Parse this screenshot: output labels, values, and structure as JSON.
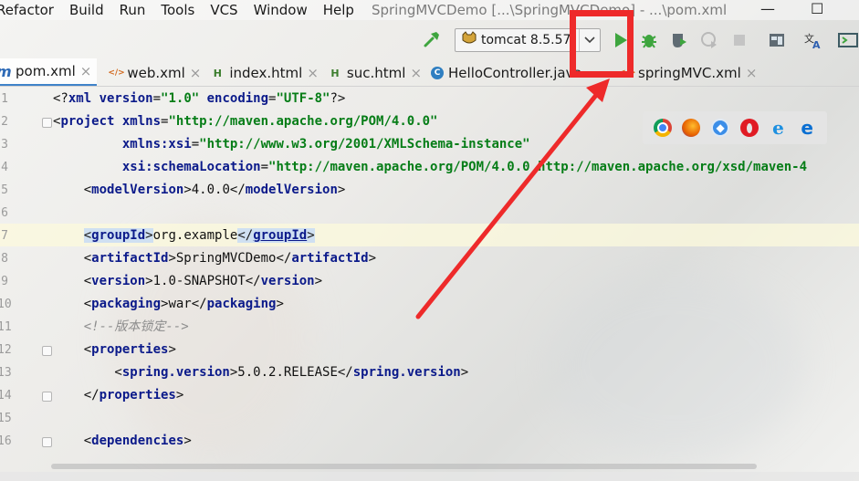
{
  "menu": {
    "items": [
      "Refactor",
      "Build",
      "Run",
      "Tools",
      "VCS",
      "Window",
      "Help"
    ],
    "title": "SpringMVCDemo [...\\SpringMVCDemo] - ...\\pom.xml",
    "minimize": "—",
    "maximize": "☐"
  },
  "toolbar": {
    "run_config": "tomcat 8.5.57"
  },
  "tabs": [
    {
      "label": "pom.xml",
      "icon": "m",
      "active": true
    },
    {
      "label": "web.xml",
      "icon": "</>",
      "active": false
    },
    {
      "label": "index.html",
      "icon": "H",
      "active": false
    },
    {
      "label": "suc.html",
      "icon": "H",
      "active": false
    },
    {
      "label": "HelloController.java",
      "icon": "C",
      "active": false
    },
    {
      "label": "springMVC.xml",
      "icon": "</>",
      "active": false
    }
  ],
  "editor": {
    "line_numbers": [
      "1",
      "2",
      "3",
      "4",
      "5",
      "6",
      "7",
      "8",
      "9",
      "10",
      "11",
      "12",
      "13",
      "14",
      "15",
      "16"
    ],
    "lines": [
      {
        "parts": [
          [
            "txt",
            "<?"
          ],
          [
            "tag",
            "xml "
          ],
          [
            "attr",
            "version"
          ],
          [
            "txt",
            "="
          ],
          [
            "val",
            "\"1.0\" "
          ],
          [
            "attr",
            "encoding"
          ],
          [
            "txt",
            "="
          ],
          [
            "val",
            "\"UTF-8\""
          ],
          [
            "txt",
            "?>"
          ]
        ]
      },
      {
        "parts": [
          [
            "txt",
            "<"
          ],
          [
            "tag",
            "project "
          ],
          [
            "attr",
            "xmlns"
          ],
          [
            "txt",
            "="
          ],
          [
            "val",
            "\"http://maven.apache.org/POM/4.0.0\""
          ]
        ]
      },
      {
        "parts": [
          [
            "txt",
            "         "
          ],
          [
            "attr",
            "xmlns:xsi"
          ],
          [
            "txt",
            "="
          ],
          [
            "val",
            "\"http://www.w3.org/2001/XMLSchema-instance\""
          ]
        ]
      },
      {
        "parts": [
          [
            "txt",
            "         "
          ],
          [
            "attr",
            "xsi:schemaLocation"
          ],
          [
            "txt",
            "="
          ],
          [
            "val",
            "\"http://maven.apache.org/POM/4.0.0 http://maven.apache.org/xsd/maven-4"
          ]
        ]
      },
      {
        "parts": [
          [
            "txt",
            "    <"
          ],
          [
            "tag",
            "modelVersion"
          ],
          [
            "txt",
            ">4.0.0</"
          ],
          [
            "tag",
            "modelVersion"
          ],
          [
            "txt",
            ">"
          ]
        ]
      },
      {
        "parts": []
      },
      {
        "parts": [
          [
            "txt",
            "    "
          ],
          [
            "hl",
            "<groupId>"
          ],
          [
            "txt",
            "org.example"
          ],
          [
            "hl",
            "</groupId>"
          ]
        ]
      },
      {
        "parts": [
          [
            "txt",
            "    <"
          ],
          [
            "tag",
            "artifactId"
          ],
          [
            "txt",
            ">SpringMVCDemo</"
          ],
          [
            "tag",
            "artifactId"
          ],
          [
            "txt",
            ">"
          ]
        ]
      },
      {
        "parts": [
          [
            "txt",
            "    <"
          ],
          [
            "tag",
            "version"
          ],
          [
            "txt",
            ">1.0-SNAPSHOT</"
          ],
          [
            "tag",
            "version"
          ],
          [
            "txt",
            ">"
          ]
        ]
      },
      {
        "parts": [
          [
            "txt",
            "    <"
          ],
          [
            "tag",
            "packaging"
          ],
          [
            "txt",
            ">war</"
          ],
          [
            "tag",
            "packaging"
          ],
          [
            "txt",
            ">"
          ]
        ]
      },
      {
        "parts": [
          [
            "txt",
            "    "
          ],
          [
            "cmt",
            "<!--版本锁定-->"
          ]
        ]
      },
      {
        "parts": [
          [
            "txt",
            "    <"
          ],
          [
            "tag",
            "properties"
          ],
          [
            "txt",
            ">"
          ]
        ]
      },
      {
        "parts": [
          [
            "txt",
            "        <"
          ],
          [
            "tag",
            "spring.version"
          ],
          [
            "txt",
            ">5.0.2.RELEASE</"
          ],
          [
            "tag",
            "spring.version"
          ],
          [
            "txt",
            ">"
          ]
        ]
      },
      {
        "parts": [
          [
            "txt",
            "    </"
          ],
          [
            "tag",
            "properties"
          ],
          [
            "txt",
            ">"
          ]
        ]
      },
      {
        "parts": []
      },
      {
        "parts": [
          [
            "txt",
            "    <"
          ],
          [
            "tag",
            "dependencies"
          ],
          [
            "txt",
            ">"
          ]
        ]
      }
    ]
  },
  "browsers": [
    "chrome-icon",
    "firefox-icon",
    "safari-icon",
    "opera-icon",
    "ie-icon",
    "edge-icon"
  ],
  "colors": {
    "annotation": "#ee2a2a",
    "run_green": "#3ea53e",
    "tag": "#0b1a8a",
    "value": "#067d17"
  }
}
